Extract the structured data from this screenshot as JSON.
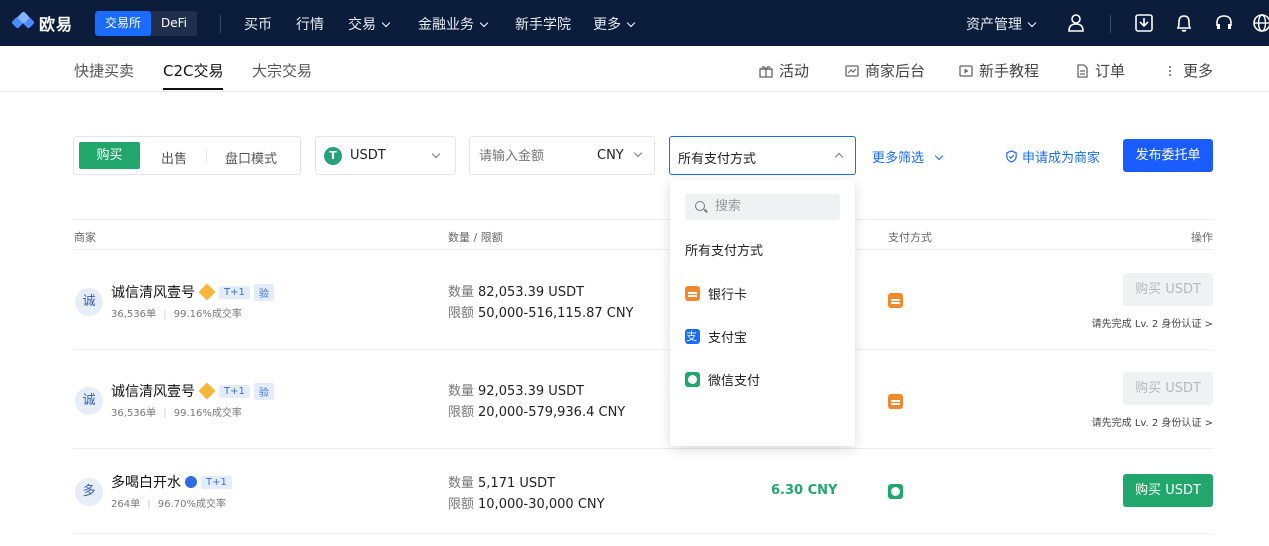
{
  "topnav": {
    "logo": "欧易",
    "seg": [
      "交易所",
      "DeFi"
    ],
    "items": [
      {
        "label": "买币",
        "caret": false
      },
      {
        "label": "行情",
        "caret": false
      },
      {
        "label": "交易",
        "caret": true
      },
      {
        "label": "金融业务",
        "caret": true
      },
      {
        "label": "新手学院",
        "caret": false
      },
      {
        "label": "更多",
        "caret": true
      }
    ],
    "asset": "资产管理"
  },
  "subnav": {
    "tabs": [
      "快捷买卖",
      "C2C交易",
      "大宗交易"
    ],
    "right": [
      "活动",
      "商家后台",
      "新手教程",
      "订单",
      "更多"
    ]
  },
  "filters": {
    "trade_tabs": [
      "购买",
      "出售",
      "盘口模式"
    ],
    "coin": "USDT",
    "amount_placeholder": "请输入金额",
    "currency": "CNY",
    "payment": "所有支付方式",
    "more_filters": "更多筛选",
    "apply_merchant": "申请成为商家",
    "post_ad": "发布委托单"
  },
  "dropdown": {
    "search_placeholder": "搜索",
    "options": [
      {
        "label": "所有支付方式",
        "icon": "none"
      },
      {
        "label": "银行卡",
        "icon": "bank-card-icon"
      },
      {
        "label": "支付宝",
        "icon": "alipay-icon"
      },
      {
        "label": "微信支付",
        "icon": "wechat-pay-icon"
      }
    ]
  },
  "table": {
    "headers": {
      "merchant": "商家",
      "qty": "数量 / 限额",
      "payment": "支付方式",
      "action": "操作"
    },
    "qty_label": "数量",
    "limit_label": "限额",
    "rows": [
      {
        "avatar": "诚",
        "name": "诚信清风壹号",
        "badges": [
          "T+1",
          "验"
        ],
        "mark": "diamond",
        "orders": "36,536单",
        "rate": "99.16%成交率",
        "qty": "82,053.39 USDT",
        "limit": "50,000-516,115.87 CNY",
        "price": "",
        "pay": "bank",
        "button": "购买 USDT",
        "enabled": false,
        "note": "请先完成 Lv. 2 身份认证 >"
      },
      {
        "avatar": "诚",
        "name": "诚信清风壹号",
        "badges": [
          "T+1",
          "验"
        ],
        "mark": "diamond",
        "orders": "36,536单",
        "rate": "99.16%成交率",
        "qty": "92,053.39 USDT",
        "limit": "20,000-579,936.4 CNY",
        "price": "",
        "pay": "bank",
        "button": "购买 USDT",
        "enabled": false,
        "note": "请先完成 Lv. 2 身份认证 >"
      },
      {
        "avatar": "多",
        "name": "多喝白开水",
        "badges": [
          "T+1"
        ],
        "mark": "verified",
        "orders": "264单",
        "rate": "96.70%成交率",
        "qty": "5,171 USDT",
        "limit": "10,000-30,000 CNY",
        "price": "6.30 CNY",
        "pay": "wechat",
        "button": "购买 USDT",
        "enabled": true,
        "note": ""
      }
    ]
  },
  "colors": {
    "nav_bg": "#0b1d3a",
    "primary": "#1a5cff",
    "buy_green": "#21a66b",
    "bank": "#f0882d"
  }
}
